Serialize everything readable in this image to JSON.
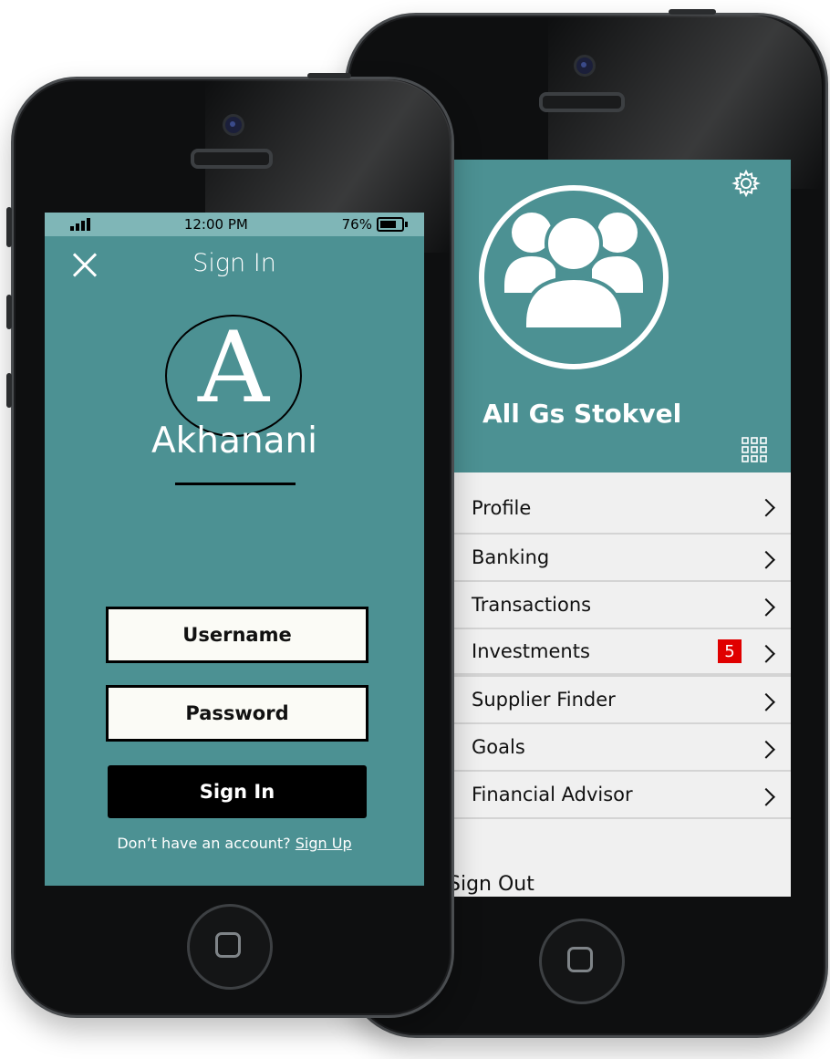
{
  "signin_screen": {
    "status_bar": {
      "time": "12:00 PM",
      "battery_percent": "76%",
      "battery_level": 0.76,
      "signal_bars": 4
    },
    "title": "Sign In",
    "logo_letter": "A",
    "brand_name": "Akhanani",
    "username_label": "Username",
    "password_label": "Password",
    "signin_button_label": "Sign In",
    "no_account_text": "Don’t have an account?",
    "signup_link_text": "Sign Up"
  },
  "menu_screen": {
    "group_name": "All Gs Stokvel",
    "items": [
      {
        "label": "Profile"
      },
      {
        "label": "Banking"
      },
      {
        "label": "Transactions"
      },
      {
        "label": "Investments",
        "badge": "5"
      },
      {
        "label": "Supplier Finder"
      },
      {
        "label": "Goals"
      },
      {
        "label": "Financial Advisor"
      }
    ],
    "signout_label": "Sign Out"
  },
  "colors": {
    "teal": "#4c9193",
    "status_bar": "#7fb6b7",
    "badge": "#e00000",
    "phone_body": "#0e0f10"
  },
  "icons": [
    "close-icon",
    "gear-icon",
    "group-avatar-icon",
    "apps-grid-icon",
    "chevron-right-icon",
    "home-button-icon"
  ]
}
